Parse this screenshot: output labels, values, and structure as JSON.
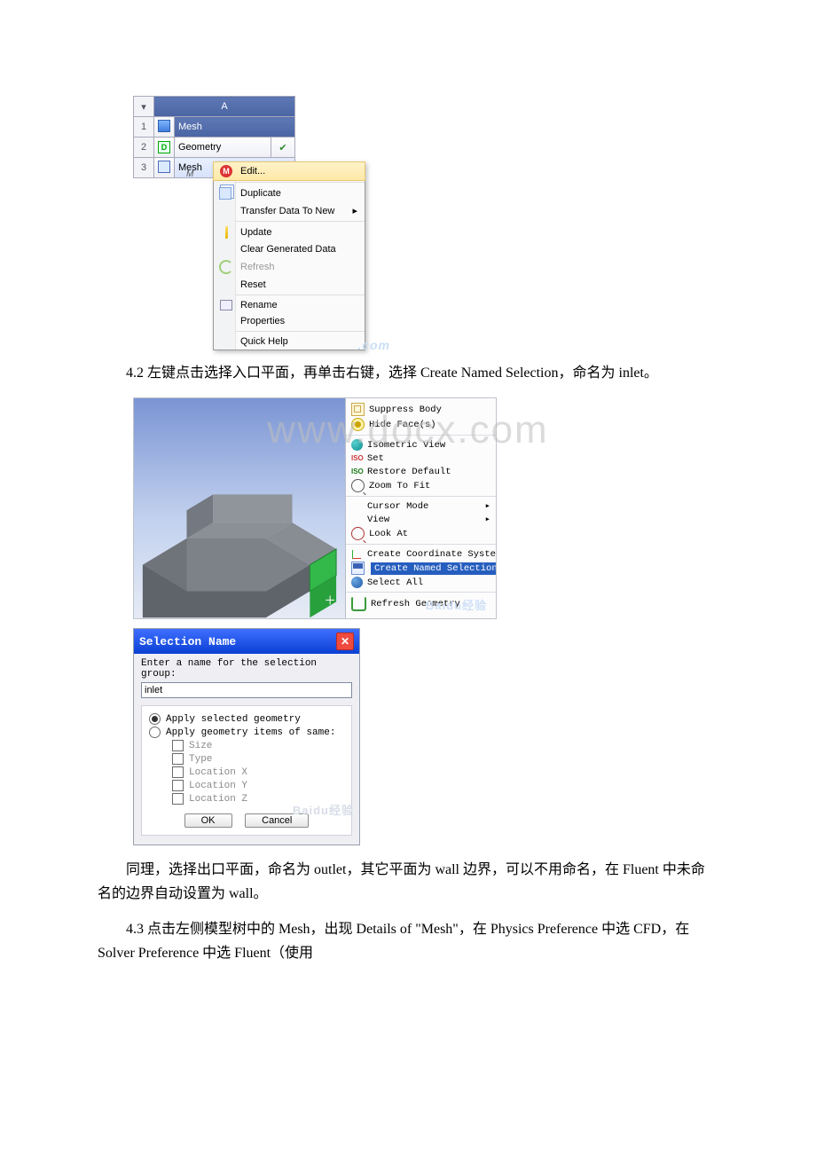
{
  "watermark_doc": "www.docx.com",
  "watermark_baidu": "Baidu经验",
  "watermark_small": ".com",
  "fig1": {
    "column": "A",
    "system_label": "M",
    "rows": [
      {
        "num": "1",
        "label": "Mesh"
      },
      {
        "num": "2",
        "label": "Geometry"
      },
      {
        "num": "3",
        "label": "Mesh"
      }
    ],
    "menu": [
      "Edit...",
      "Duplicate",
      "Transfer Data To New",
      "Update",
      "Clear Generated Data",
      "Refresh",
      "Reset",
      "Rename",
      "Properties",
      "Quick Help"
    ]
  },
  "para_4_2": "4.2 左键点击选择入口平面，再单击右键，选择 Create Named Selection，命名为 inlet。",
  "fig2": {
    "menu": [
      "Suppress Body",
      "Hide Face(s)",
      "Isometric View",
      "Set",
      "Restore Default",
      "Zoom To Fit",
      "Cursor Mode",
      "View",
      "Look At",
      "Create Coordinate System",
      "Create Named Selection",
      "Select All",
      "Refresh Geometry"
    ]
  },
  "fig3": {
    "title": "Selection Name",
    "prompt": "Enter a name for the selection group:",
    "value": "inlet",
    "options": [
      "Apply selected geometry",
      "Apply geometry items of same:"
    ],
    "sub": [
      "Size",
      "Type",
      "Location X",
      "Location Y",
      "Location Z"
    ],
    "ok": "OK",
    "cancel": "Cancel"
  },
  "para_outlet": "同理，选择出口平面，命名为 outlet，其它平面为 wall 边界，可以不用命名，在 Fluent 中未命名的边界自动设置为 wall。",
  "para_4_3": "4.3 点击左侧模型树中的 Mesh，出现 Details of \"Mesh\"，在 Physics Preference 中选 CFD，在 Solver Preference 中选 Fluent（使用"
}
